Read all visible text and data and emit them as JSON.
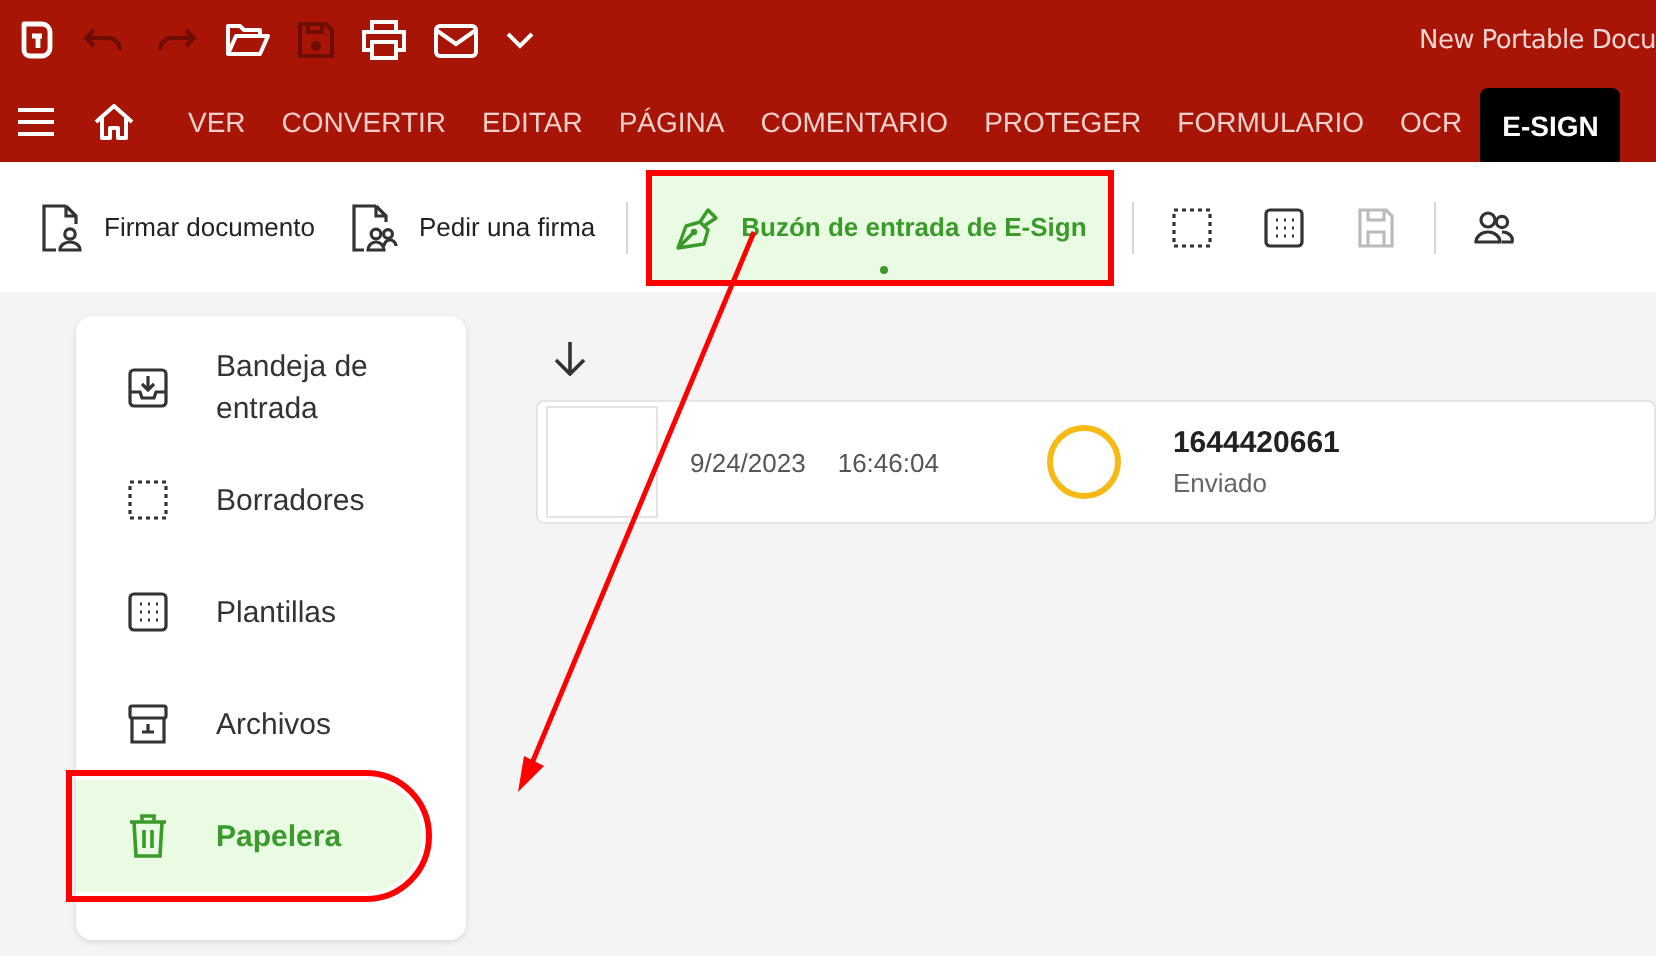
{
  "title_bar": {
    "quick_access": [
      {
        "kind": "undo",
        "disabled": true
      },
      {
        "kind": "redo",
        "disabled": true
      },
      {
        "kind": "open",
        "disabled": false
      },
      {
        "kind": "save",
        "disabled": true
      },
      {
        "kind": "print",
        "disabled": false
      },
      {
        "kind": "mail",
        "disabled": false
      },
      {
        "kind": "more",
        "disabled": false
      }
    ],
    "title": "New Portable Docu"
  },
  "menu": {
    "tabs": [
      {
        "label": "VER",
        "selected": false
      },
      {
        "label": "CONVERTIR",
        "selected": false
      },
      {
        "label": "EDITAR",
        "selected": false
      },
      {
        "label": "PÁGINA",
        "selected": false
      },
      {
        "label": "COMENTARIO",
        "selected": false
      },
      {
        "label": "PROTEGER",
        "selected": false
      },
      {
        "label": "FORMULARIO",
        "selected": false
      },
      {
        "label": "OCR",
        "selected": false
      },
      {
        "label": "E-SIGN",
        "selected": true
      }
    ]
  },
  "toolbar": [
    {
      "kind": "sign",
      "label": "Firmar documento",
      "selected": false,
      "annotated": false
    },
    {
      "kind": "request",
      "label": "Pedir una firma",
      "selected": false,
      "annotated": false
    },
    {
      "kind": "separator"
    },
    {
      "kind": "inbox",
      "label": "Buzón de entrada de E-Sign",
      "selected": true,
      "annotated": true
    },
    {
      "kind": "separator"
    },
    {
      "kind": "drafts",
      "disabled": false
    },
    {
      "kind": "templates",
      "disabled": false
    },
    {
      "kind": "save",
      "disabled": true
    },
    {
      "kind": "separator"
    },
    {
      "kind": "contacts",
      "disabled": false
    }
  ],
  "sidebar": {
    "items": [
      {
        "kind": "inbox",
        "label": "Bandeja de entrada",
        "selected": false,
        "annotated": false
      },
      {
        "kind": "drafts",
        "label": "Borradores",
        "selected": false,
        "annotated": false
      },
      {
        "kind": "templates",
        "label": "Plantillas",
        "selected": false,
        "annotated": false
      },
      {
        "kind": "archive",
        "label": "Archivos",
        "selected": false,
        "annotated": false
      },
      {
        "kind": "trash",
        "label": "Papelera",
        "selected": true,
        "annotated": true
      }
    ]
  },
  "documents": [
    {
      "date": "9/24/2023",
      "time": "16:46:04",
      "id": "1644420661",
      "status": "Enviado",
      "color": "#f7b916"
    }
  ]
}
